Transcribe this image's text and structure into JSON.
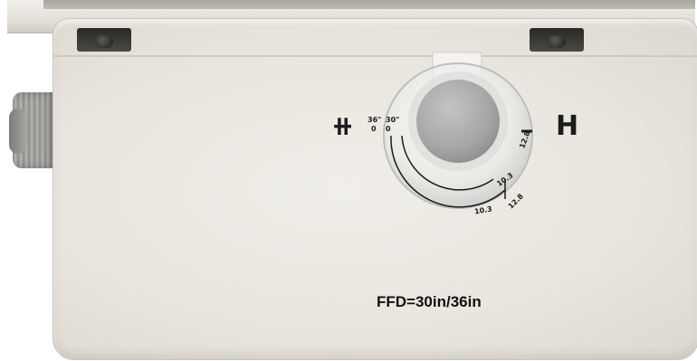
{
  "label": {
    "ffd": "FFD=30in/36in"
  },
  "dial": {
    "inner_top_labels": [
      "36\"",
      "30\""
    ],
    "inner_small_labels": [
      "0",
      "0"
    ],
    "scale_labels": [
      "10.3",
      "12.8",
      "10.3",
      "12.8"
    ]
  },
  "symbols": {
    "left": "⧺",
    "right": "H"
  },
  "colors": {
    "housing": "#e9e6df",
    "knob": "#a9aba9",
    "ink": "#1b1b1b"
  }
}
